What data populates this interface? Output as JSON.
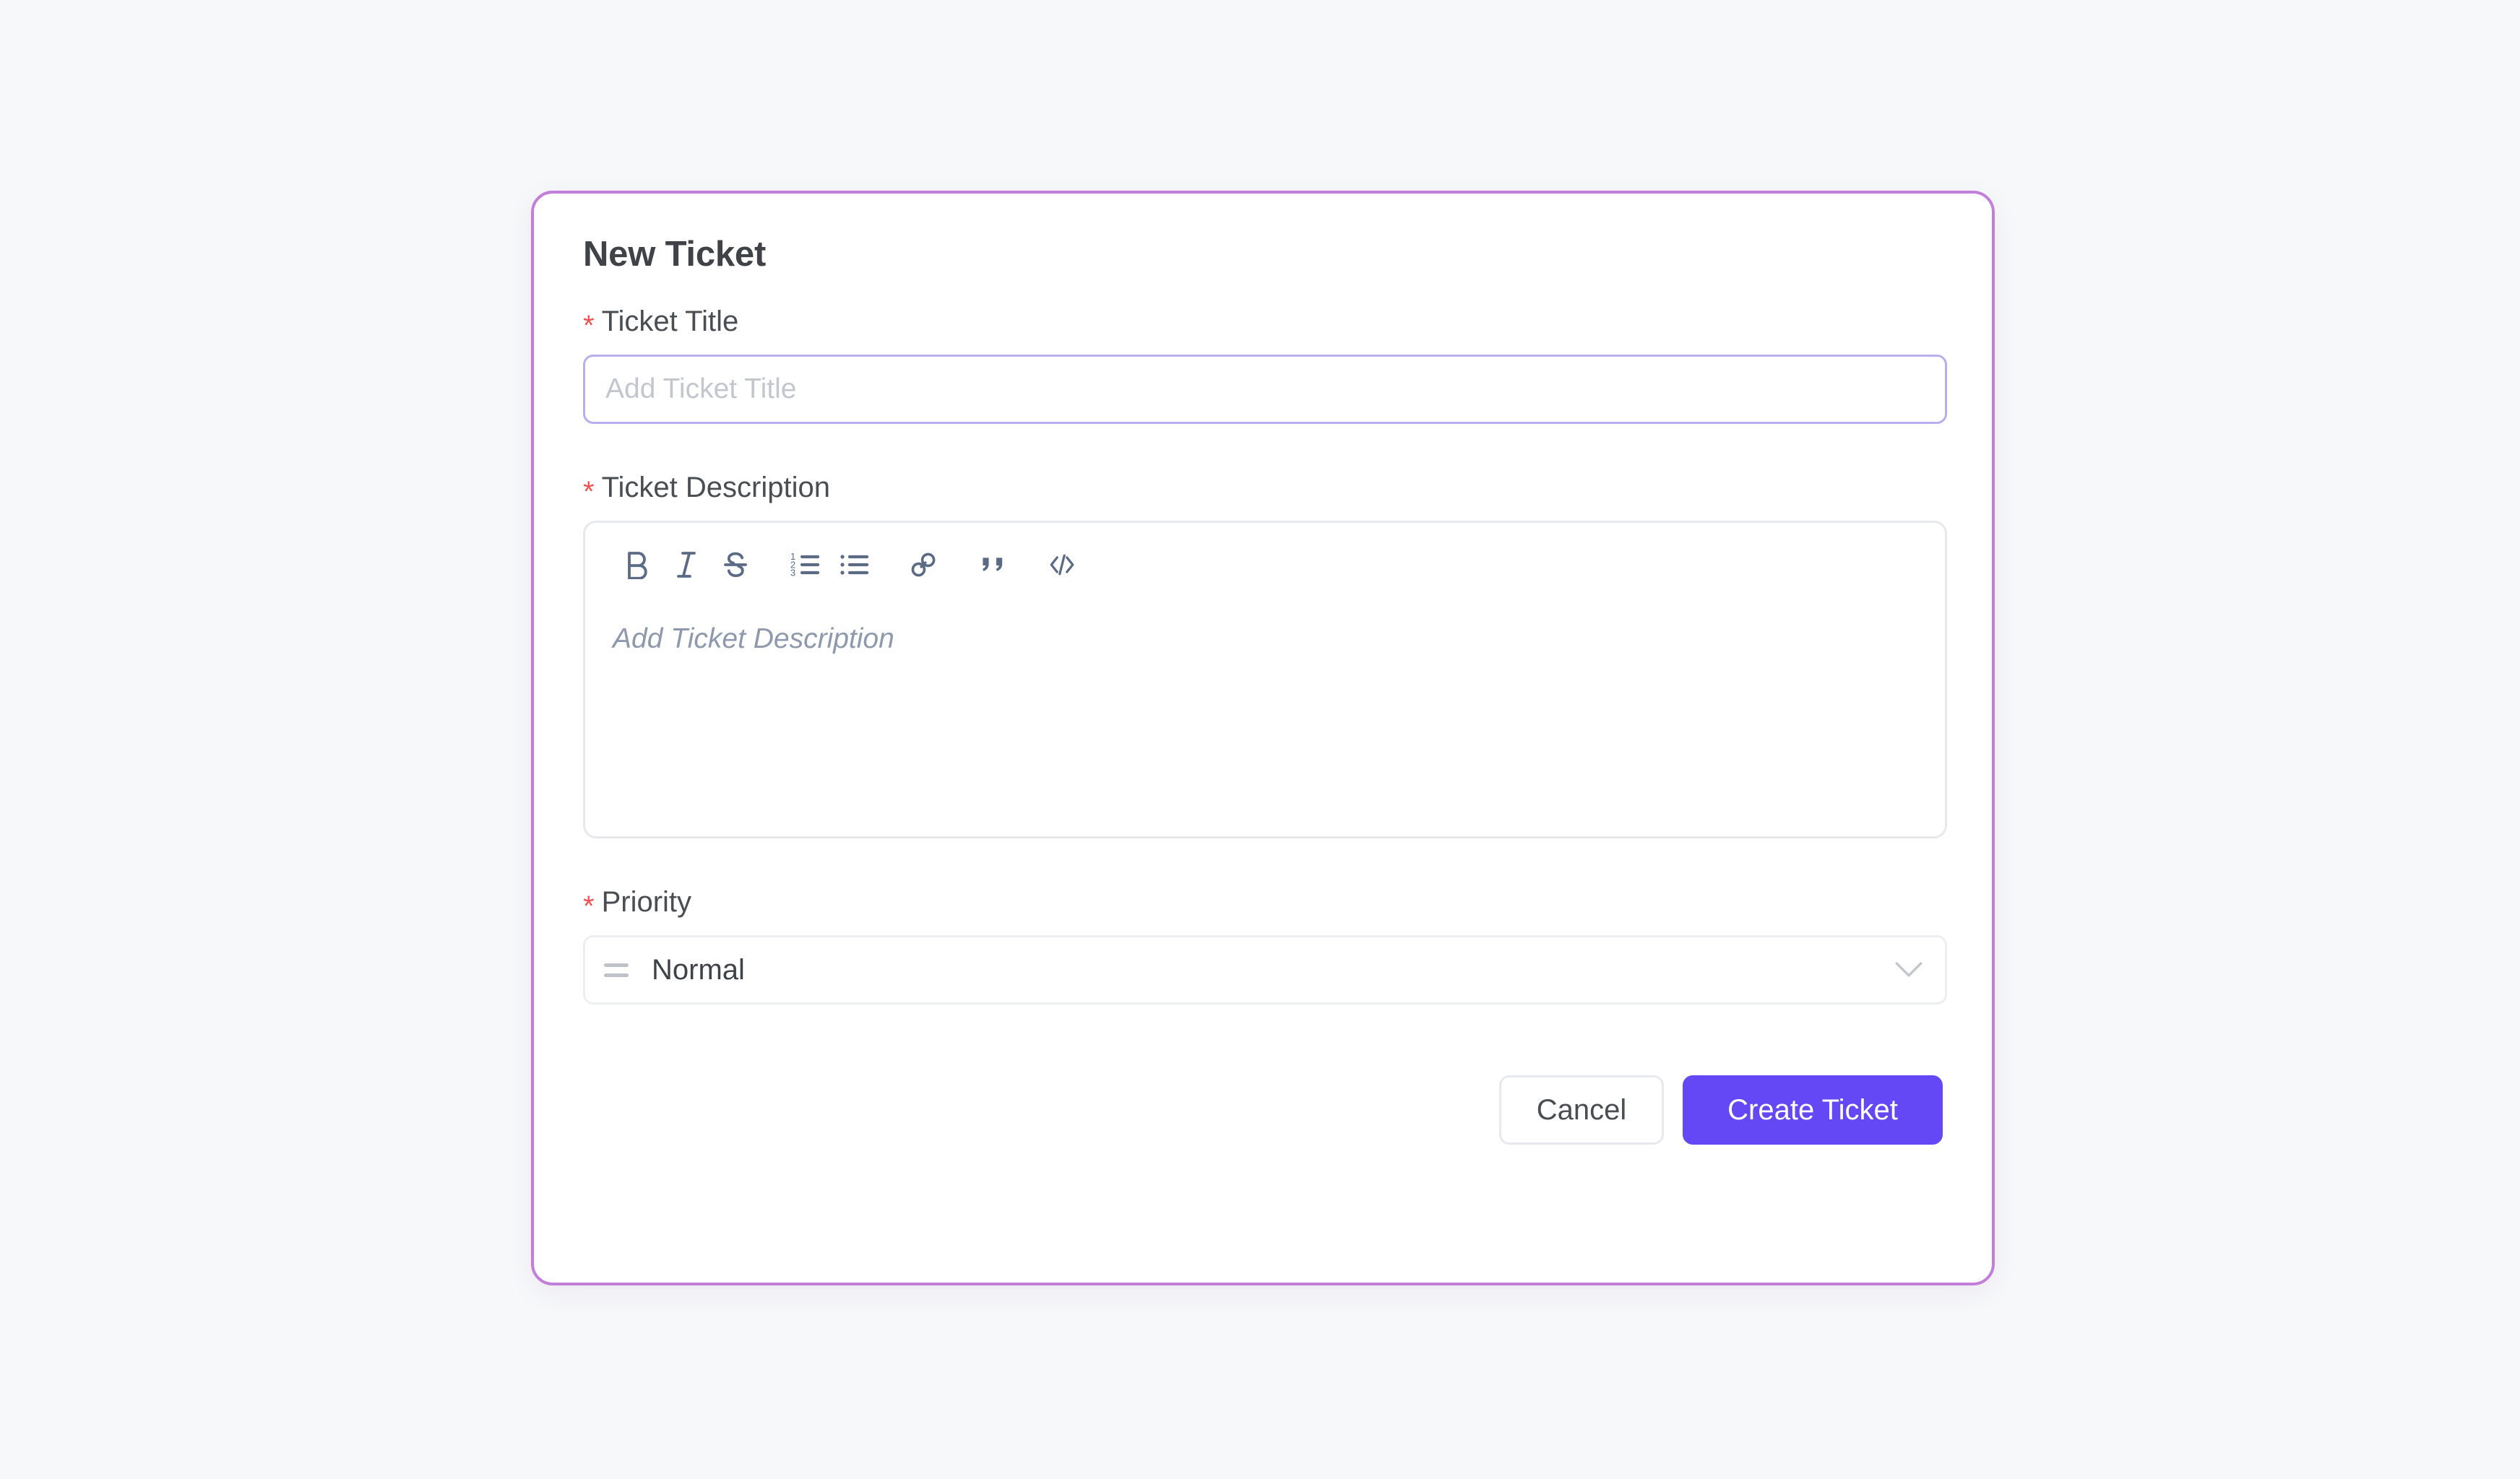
{
  "dialog": {
    "title": "New Ticket"
  },
  "fields": {
    "ticket_title": {
      "label": "Ticket Title",
      "required_marker": "*",
      "placeholder": "Add Ticket Title",
      "value": ""
    },
    "ticket_description": {
      "label": "Ticket Description",
      "required_marker": "*",
      "placeholder": "Add Ticket Description",
      "value": ""
    },
    "priority": {
      "label": "Priority",
      "required_marker": "*",
      "selected": "Normal"
    }
  },
  "editor_toolbar": [
    {
      "name": "bold-icon",
      "title": "Bold"
    },
    {
      "name": "italic-icon",
      "title": "Italic"
    },
    {
      "name": "strikethrough-icon",
      "title": "Strikethrough"
    },
    {
      "name": "ordered-list-icon",
      "title": "Numbered List"
    },
    {
      "name": "bullet-list-icon",
      "title": "Bullet List"
    },
    {
      "name": "link-icon",
      "title": "Link"
    },
    {
      "name": "quote-icon",
      "title": "Blockquote"
    },
    {
      "name": "code-icon",
      "title": "Code"
    }
  ],
  "ordered_list_numbers": [
    "1",
    "2",
    "3"
  ],
  "footer": {
    "cancel_label": "Cancel",
    "submit_label": "Create Ticket"
  },
  "colors": {
    "page_background": "#f7f8fa",
    "dialog_border": "#c27fda",
    "primary_button": "#6548f5",
    "required_asterisk": "#f05252",
    "focused_input_border": "#b9aef0",
    "toolbar_icon": "#5b6a85",
    "placeholder_muted": "#c3c7cd",
    "editor_placeholder": "#8e99ad"
  }
}
